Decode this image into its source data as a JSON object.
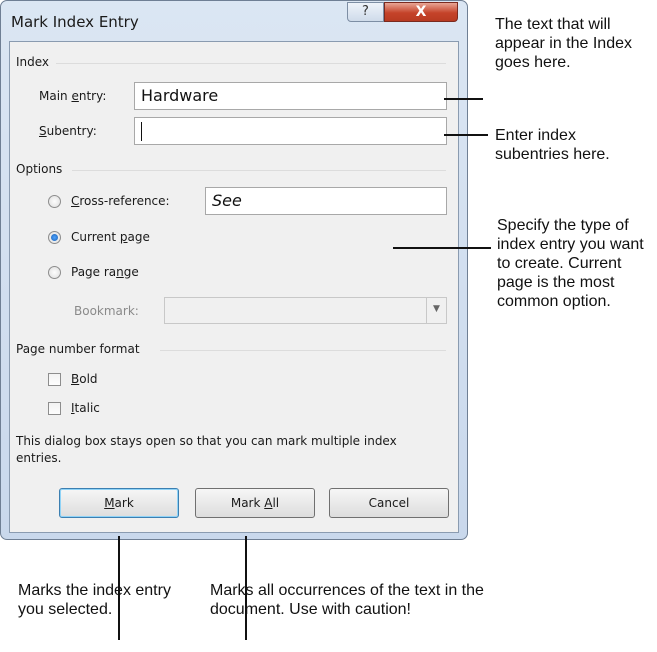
{
  "dialog": {
    "title": "Mark Index Entry",
    "help_glyph": "?",
    "close_glyph": "X",
    "index_group": "Index",
    "main_entry_label_pre": "Main ",
    "main_entry_label_acc": "e",
    "main_entry_label_post": "ntry:",
    "main_entry_value": "Hardware",
    "subentry_label_acc": "S",
    "subentry_label_post": "ubentry:",
    "subentry_value": "",
    "options_group": "Options",
    "cross_ref_acc": "C",
    "cross_ref_post": "ross-reference:",
    "cross_ref_value": "See",
    "current_page_pre": "Current ",
    "current_page_acc": "p",
    "current_page_post": "age",
    "page_range_pre": "Page ra",
    "page_range_acc": "n",
    "page_range_post": "ge",
    "bookmark_label": "Bookmark:",
    "bookmark_value": "",
    "page_number_format_group": "Page number format",
    "bold_acc": "B",
    "bold_post": "old",
    "italic_acc": "I",
    "italic_post": "talic",
    "info_text": "This dialog box stays open so that you can mark multiple index entries.",
    "mark_acc": "M",
    "mark_post": "ark",
    "mark_all_pre": "Mark ",
    "mark_all_acc": "A",
    "mark_all_post": "ll",
    "cancel": "Cancel"
  },
  "state": {
    "selected_option": "Current page",
    "bold_checked": false,
    "italic_checked": false
  },
  "callouts": {
    "index_text": "The text that will appear in the Index goes here.",
    "subentries": "Enter index subentries here.",
    "type": "Specify the type of index entry you want to create. Current page is the most common option.",
    "mark": "Marks the index entry you selected.",
    "mark_all": "Marks all occurrences of the text in the document. Use with caution!"
  }
}
